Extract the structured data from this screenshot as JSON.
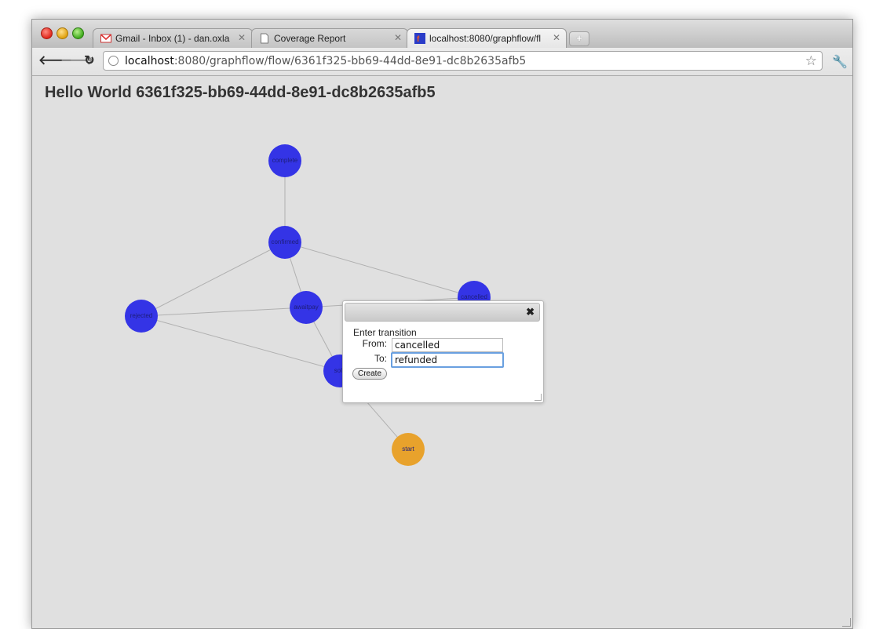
{
  "browser": {
    "tabs": [
      {
        "label": "Gmail - Inbox (1) - dan.oxla",
        "icon": "gmail-icon"
      },
      {
        "label": "Coverage Report",
        "icon": "page-icon"
      },
      {
        "label": "localhost:8080/graphflow/fl",
        "icon": "site-favicon"
      }
    ],
    "url_host": "localhost",
    "url_path": ":8080/graphflow/flow/6361f325-bb69-44dd-8e91-dc8b2635afb5"
  },
  "page": {
    "title": "Hello World 6361f325-bb69-44dd-8e91-dc8b2635afb5"
  },
  "graph": {
    "node_color": "#3434e6",
    "start_color": "#e8a22c",
    "edge_color": "#b0b0b0",
    "nodes": [
      {
        "id": "complete",
        "label": "complete"
      },
      {
        "id": "confirmed",
        "label": "confirmed"
      },
      {
        "id": "cancelled",
        "label": "cancelled"
      },
      {
        "id": "rejected",
        "label": "rejected"
      },
      {
        "id": "awaitpay",
        "label": "awaitpay"
      },
      {
        "id": "sold",
        "label": "sold"
      },
      {
        "id": "start",
        "label": "start"
      }
    ]
  },
  "dialog": {
    "prompt": "Enter transition",
    "from_label": "From:",
    "to_label": "To:",
    "from_value": "cancelled",
    "to_value": "refunded",
    "create_label": "Create",
    "close_symbol": "✖"
  }
}
